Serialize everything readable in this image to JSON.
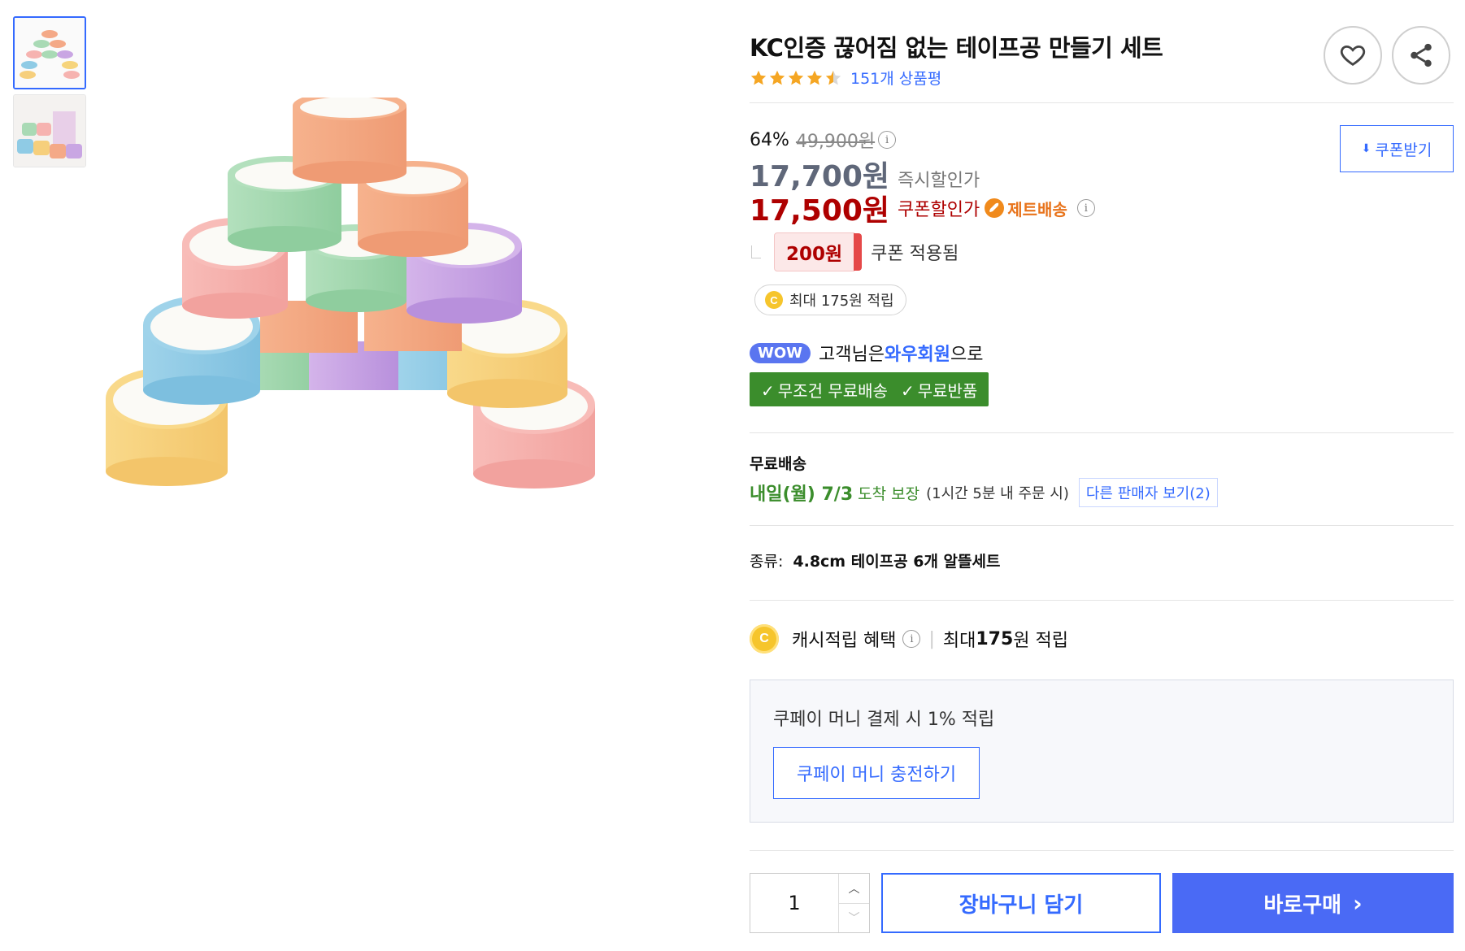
{
  "thumbnails": [
    {
      "alt": "tape roll pyramid thumbnail",
      "selected": true
    },
    {
      "alt": "tape roll set thumbnail",
      "selected": false
    }
  ],
  "product": {
    "title": "KC인증 끊어짐 없는 테이프공 만들기 세트",
    "rating": 4.5,
    "review_text": "151개 상품평"
  },
  "pricing": {
    "discount_rate": "64%",
    "original_price": "49,900원",
    "instant_price": "17,700원",
    "instant_label": "즉시할인가",
    "coupon_price": "17,500원",
    "coupon_label": "쿠폰할인가",
    "jet_label": "제트배송",
    "coupon_amount": "200원",
    "coupon_applied_text": "쿠폰 적용됨",
    "coupon_button": "쿠폰받기",
    "max_cash": "최대 175원 적립"
  },
  "wow": {
    "badge": "WOW",
    "prefix": "고객님은 ",
    "highlight": "와우회원",
    "suffix": "으로",
    "benefit1": "무조건 무료배송",
    "benefit2": "무료반품"
  },
  "shipping": {
    "title": "무료배송",
    "date": "내일(월) 7/3",
    "guarantee": "도착 보장",
    "condition": "(1시간 5분 내 주문 시)",
    "other_sellers": "다른 판매자 보기(2)"
  },
  "option": {
    "label": "종류:",
    "value": "4.8cm 테이프공 6개 알뜰세트"
  },
  "cashback": {
    "label": "캐시적립 혜택",
    "value_prefix": "최대 ",
    "value_amount": "175",
    "value_suffix": "원 적립"
  },
  "cpay": {
    "text": "쿠페이 머니 결제 시 1% 적립",
    "button": "쿠페이 머니 충전하기"
  },
  "purchase": {
    "quantity": "1",
    "cart_button": "장바구니 담기",
    "buy_button": "바로구매"
  },
  "colors": {
    "accent": "#346aff",
    "price_red": "#ae0000",
    "green": "#3b8d2c",
    "star": "#f5a623"
  }
}
